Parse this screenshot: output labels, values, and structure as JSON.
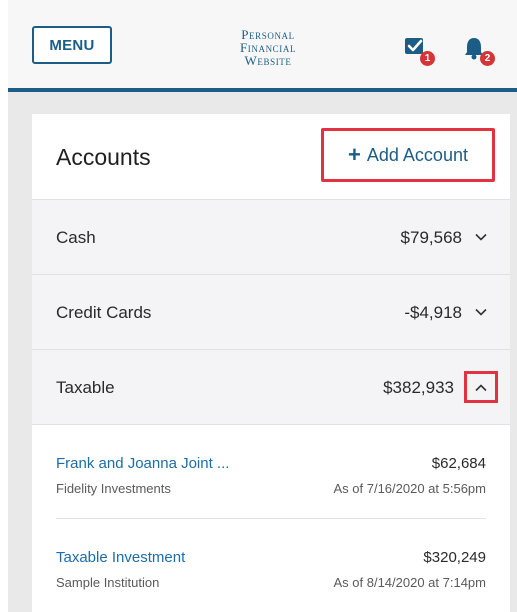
{
  "header": {
    "menu_label": "MENU",
    "brand_line1": "Personal",
    "brand_line2": "Financial",
    "brand_line3": "Website",
    "tasks_badge": "1",
    "notifications_badge": "2"
  },
  "accounts": {
    "title": "Accounts",
    "add_label": "Add Account",
    "add_icon": "plus-icon",
    "groups": [
      {
        "label": "Cash",
        "amount": "$79,568",
        "expanded": false
      },
      {
        "label": "Credit Cards",
        "amount": "-$4,918",
        "expanded": false
      },
      {
        "label": "Taxable",
        "amount": "$382,933",
        "expanded": true
      }
    ],
    "items": [
      {
        "name": "Frank and Joanna Joint ...",
        "institution": "Fidelity Investments",
        "value": "$62,684",
        "as_of": "As of 7/16/2020 at 5:56pm"
      },
      {
        "name": "Taxable Investment",
        "institution": "Sample Institution",
        "value": "$320,249",
        "as_of": "As of 8/14/2020 at 7:14pm"
      }
    ]
  },
  "colors": {
    "brand": "#1c5d87",
    "link": "#1c6da8",
    "highlight": "#e0323f",
    "badge": "#d43535"
  }
}
